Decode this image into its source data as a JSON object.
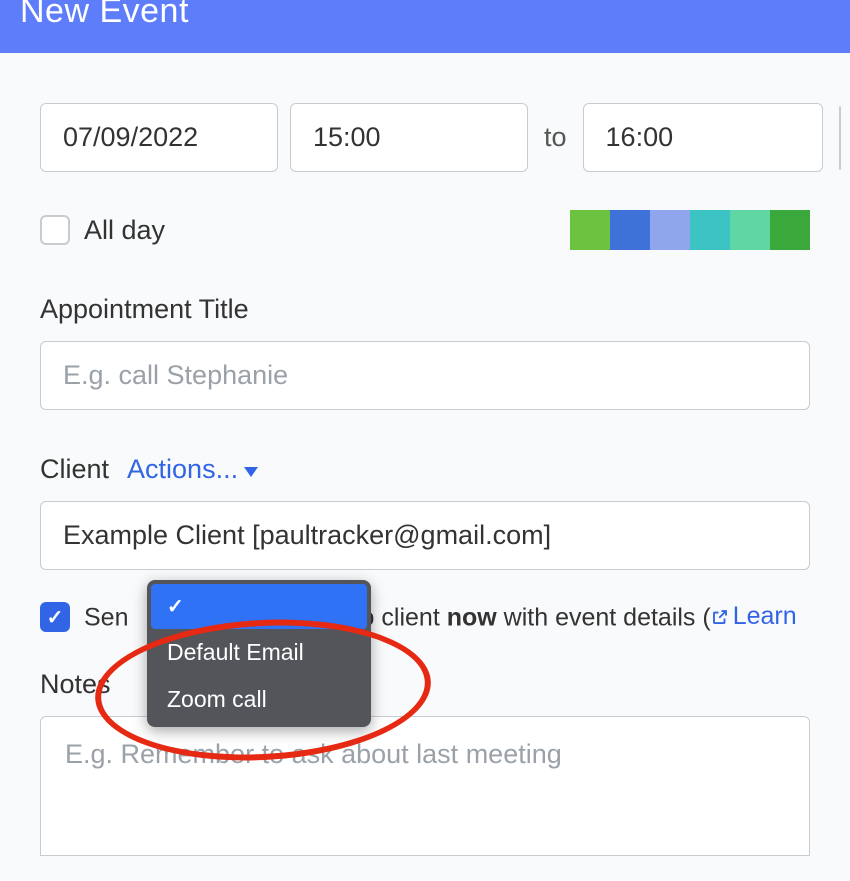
{
  "header": {
    "title": "New Event"
  },
  "datetime": {
    "date": "07/09/2022",
    "start": "15:00",
    "to": "to",
    "end": "16:00"
  },
  "allday": {
    "label": "All day",
    "checked": false
  },
  "colors": [
    "#6bc33f",
    "#3f72d8",
    "#8fa6ec",
    "#3cc3c3",
    "#5fd6a3",
    "#3aa83a"
  ],
  "title_section": {
    "label": "Appointment Title",
    "placeholder": "E.g. call Stephanie",
    "value": ""
  },
  "client_section": {
    "label": "Client",
    "actions": "Actions...",
    "value": "Example Client [paultracker@gmail.com]"
  },
  "send": {
    "prefix": "Sen",
    "mid": "to client ",
    "now": "now",
    "suffix": " with event details (",
    "learn": "Learn",
    "checked": true
  },
  "notes": {
    "label": "Notes",
    "placeholder": "E.g. Remember to ask about last meeting",
    "value": ""
  },
  "dropdown": {
    "items": [
      {
        "label": "",
        "selected": true
      },
      {
        "label": "Default Email",
        "selected": false
      },
      {
        "label": "Zoom call",
        "selected": false
      }
    ]
  }
}
